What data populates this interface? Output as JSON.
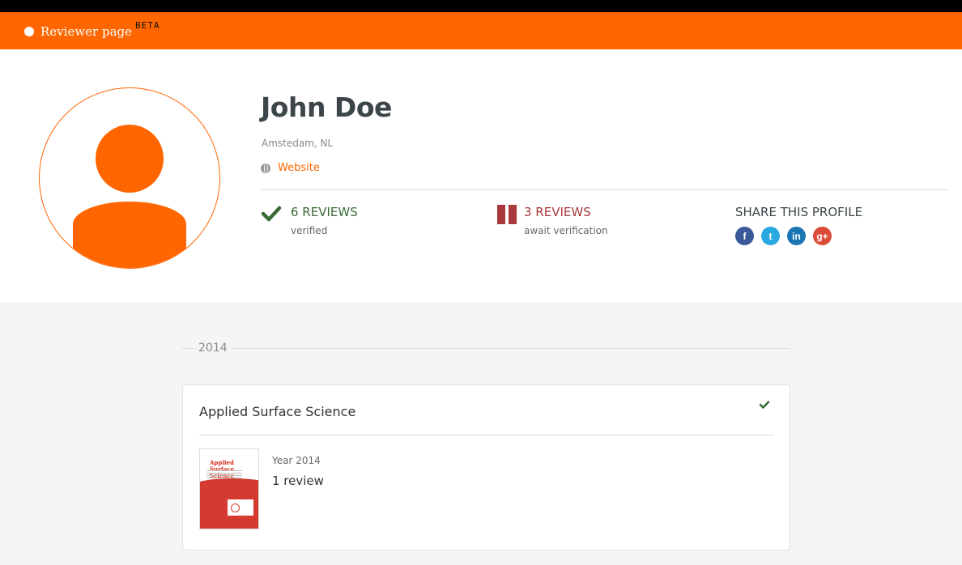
{
  "colors": {
    "accent": "#ff6600",
    "verified": "#3a6b36",
    "await": "#a9393c"
  },
  "header": {
    "title": "Reviewer page",
    "badge": "BETA"
  },
  "profile": {
    "name": "John Doe",
    "location": "Amstedam, NL",
    "website_label": "Website",
    "verified": {
      "count_label": "6 REVIEWS",
      "sub_label": "verified",
      "icon": "checkmark-icon"
    },
    "awaiting": {
      "count_label": "3 REVIEWS",
      "sub_label": "await verification",
      "icon": "pause-icon"
    },
    "share": {
      "title": "SHARE THIS PROFILE",
      "networks": [
        {
          "name": "facebook",
          "glyph": "f",
          "color": "#3b5998"
        },
        {
          "name": "twitter",
          "glyph": "t",
          "color": "#29a8e0"
        },
        {
          "name": "linkedin",
          "glyph": "in",
          "color": "#1a75b3"
        },
        {
          "name": "googleplus",
          "glyph": "g+",
          "color": "#dc4a38"
        }
      ]
    }
  },
  "timeline": {
    "year": "2014",
    "journals": [
      {
        "title": "Applied Surface Science",
        "cover_title": "Applied Surface Science",
        "year_label": "Year 2014",
        "reviews_label": "1 review"
      }
    ]
  }
}
